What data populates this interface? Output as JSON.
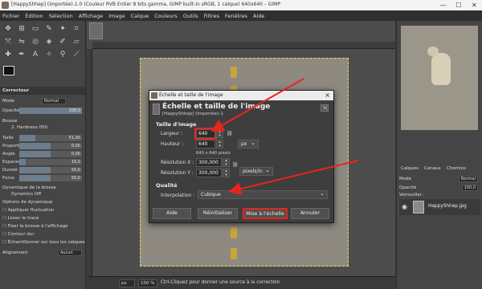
{
  "window": {
    "title": "[HappyShhep] (importée)-1.0 (Couleur RVB Entier 8 bits gamma, GIMP built-in sRGB, 1 calque) 640x640 – GIMP",
    "controls": [
      "—",
      "☐",
      "✕"
    ]
  },
  "menubar": [
    "Fichier",
    "Édition",
    "Sélection",
    "Affichage",
    "Image",
    "Calque",
    "Couleurs",
    "Outils",
    "Filtres",
    "Fenêtres",
    "Aide"
  ],
  "left_panel": {
    "tab_title": "Correcteur",
    "mode_label": "Mode",
    "mode_value": "Normal",
    "opacity_label": "Opacité",
    "opacity_value": "100,0",
    "brush_label": "Brosse",
    "brush_value": "2. Hardness 050",
    "params": [
      {
        "label": "Taille",
        "value": "51,00"
      },
      {
        "label": "Proportions",
        "value": "0,00"
      },
      {
        "label": "Angle",
        "value": "0,00"
      },
      {
        "label": "Espacement",
        "value": "10,0"
      },
      {
        "label": "Dureté",
        "value": "50,0"
      },
      {
        "label": "Force",
        "value": "50,0"
      }
    ],
    "dynamics_label": "Dynamique de la brosse",
    "dynamics_value": "Dynamics Off",
    "options": [
      "Options de dynamique",
      "Appliquer fluctuation",
      "Lisser le tracé",
      "Fixer la brosse à l'affichage",
      "Contour dur",
      "Échantillonner sur tous les calques"
    ],
    "alignment_label": "Alignement",
    "alignment_value": "Aucun"
  },
  "statusbar": {
    "unit": "px",
    "zoom": "100 %",
    "message": "Ctrl-Cliquez pour donner une source à la correction"
  },
  "right_panel": {
    "tabs": [
      "Calques",
      "Canaux",
      "Chemins"
    ],
    "mode_label": "Mode",
    "mode_value": "Normal",
    "opacity_label": "Opacité",
    "opacity_value": "100,0",
    "lock_label": "Verrouiller :",
    "layer_name": "HappyShhep.jpg"
  },
  "dialog": {
    "window_title": "Échelle et taille de l'image",
    "heading": "Échelle et taille de l'image",
    "subtitle": "[HappyShhep] (importée)-1",
    "size_section": "Taille d'image",
    "width_label": "Largeur :",
    "width_value": "640",
    "height_label": "Hauteur :",
    "height_value": "640",
    "unit_value": "px",
    "pixel_info": "640 x 640 pixels",
    "res_x_label": "Résolution X :",
    "res_x_value": "300,000",
    "res_y_label": "Résolution Y :",
    "res_y_value": "300,000",
    "res_unit": "pixels/in",
    "quality_section": "Qualité",
    "interp_label": "Interpolation :",
    "interp_value": "Cubique",
    "buttons": {
      "help": "Aide",
      "reset": "Réinitialiser",
      "scale": "Mise à l'échelle",
      "cancel": "Annuler"
    }
  },
  "colors": {
    "annotation": "#e8251c",
    "road_marks": "#c9a438"
  }
}
